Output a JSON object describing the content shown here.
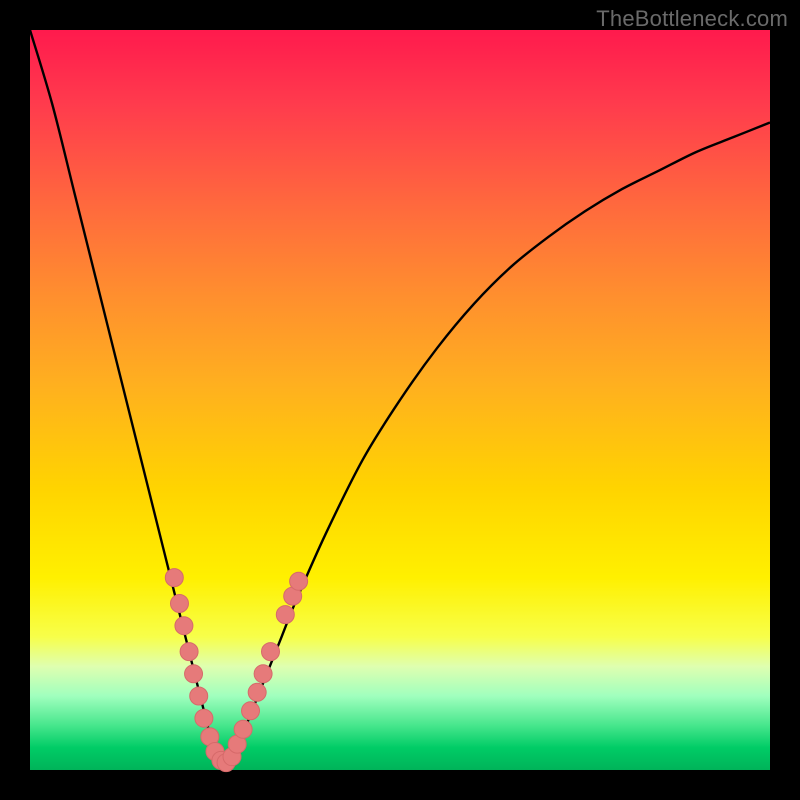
{
  "watermark": "TheBottleneck.com",
  "colors": {
    "curve": "#000000",
    "markers": "#e67a7a",
    "markers_stroke": "#d66a6a"
  },
  "chart_data": {
    "type": "line",
    "title": "",
    "xlabel": "",
    "ylabel": "",
    "xlim": [
      0,
      100
    ],
    "ylim": [
      0,
      100
    ],
    "note": "Vertical axis represents bottleneck percentage; minimum of the curve ≈ 0% at x ≈ 26. Color gradient encodes severity (green = low near bottom, red = high near top).",
    "series": [
      {
        "name": "bottleneck-curve",
        "x": [
          0,
          3,
          6,
          9,
          12,
          15,
          18,
          20,
          22,
          24,
          25,
          26,
          27,
          28,
          30,
          32,
          34,
          36,
          40,
          45,
          50,
          55,
          60,
          65,
          70,
          75,
          80,
          85,
          90,
          95,
          100
        ],
        "values": [
          100,
          90,
          78,
          66,
          54,
          42,
          30,
          22,
          14,
          6,
          2,
          0,
          1,
          3,
          8,
          13,
          18,
          23,
          32,
          42,
          50,
          57,
          63,
          68,
          72,
          75.5,
          78.5,
          81,
          83.5,
          85.5,
          87.5
        ]
      }
    ],
    "markers": {
      "name": "highlighted-points",
      "points": [
        {
          "x": 19.5,
          "y": 26
        },
        {
          "x": 20.2,
          "y": 22.5
        },
        {
          "x": 20.8,
          "y": 19.5
        },
        {
          "x": 21.5,
          "y": 16
        },
        {
          "x": 22.1,
          "y": 13
        },
        {
          "x": 22.8,
          "y": 10
        },
        {
          "x": 23.5,
          "y": 7
        },
        {
          "x": 24.3,
          "y": 4.5
        },
        {
          "x": 25.0,
          "y": 2.5
        },
        {
          "x": 25.8,
          "y": 1.3
        },
        {
          "x": 26.5,
          "y": 1.0
        },
        {
          "x": 27.3,
          "y": 1.8
        },
        {
          "x": 28.0,
          "y": 3.5
        },
        {
          "x": 28.8,
          "y": 5.5
        },
        {
          "x": 29.8,
          "y": 8
        },
        {
          "x": 30.7,
          "y": 10.5
        },
        {
          "x": 31.5,
          "y": 13
        },
        {
          "x": 32.5,
          "y": 16
        },
        {
          "x": 34.5,
          "y": 21
        },
        {
          "x": 35.5,
          "y": 23.5
        },
        {
          "x": 36.3,
          "y": 25.5
        }
      ]
    }
  }
}
